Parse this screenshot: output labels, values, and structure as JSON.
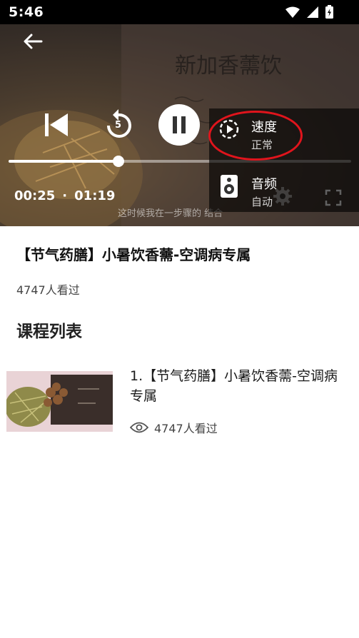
{
  "status_bar": {
    "time": "5:46",
    "icons": [
      "wifi-icon",
      "signal-icon",
      "battery-icon"
    ]
  },
  "player": {
    "current_time": "00:25",
    "separator": "·",
    "duration": "01:19",
    "progress": 0.32,
    "subtitle": "这时候我在一步骤的 结合",
    "handwritten_note": "新加香薷饮",
    "icons": [
      "back-arrow-icon",
      "skip-previous-icon",
      "replay-5-icon",
      "pause-icon",
      "settings-icon",
      "fullscreen-icon"
    ],
    "replay_seconds": "5",
    "menu": [
      {
        "title": "速度",
        "value": "正常",
        "icon": "speed-icon"
      },
      {
        "title": "音频",
        "value": "自动",
        "icon": "speaker-icon"
      }
    ],
    "highlight_color": "#e0141c"
  },
  "course": {
    "title": "【节气药膳】小暑饮香薷-空调病专属",
    "viewers": "4747人看过"
  },
  "section": {
    "title": "课程列表"
  },
  "list": [
    {
      "title": "1.【节气药膳】小暑饮香薷-空调病专属",
      "views": "4747人看过",
      "icon": "eye-icon"
    }
  ]
}
